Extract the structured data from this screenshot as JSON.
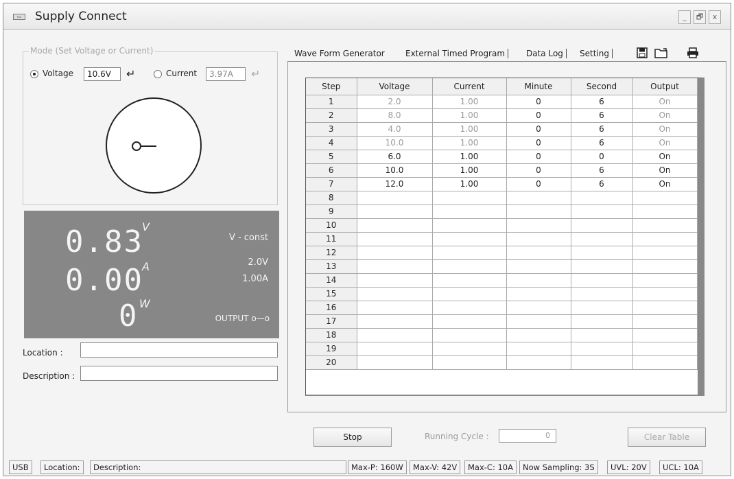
{
  "window": {
    "title": "Supply Connect",
    "app_icon": "sm-icon",
    "buttons": [
      "_",
      "🗗",
      "x"
    ]
  },
  "mode": {
    "legend": "Mode (Set Voltage or Current)",
    "voltage_label": "Voltage",
    "voltage_value": "10.6V",
    "current_label": "Current",
    "current_value": "3.97A",
    "selected": "Voltage"
  },
  "display": {
    "voltage_reading": "0.83",
    "voltage_unit": "V",
    "current_reading": "0.00",
    "current_unit": "A",
    "power_reading": "0",
    "power_unit": "W",
    "mode_text": "V - const",
    "set_voltage": "2.0V",
    "set_current": "1.00A",
    "output_text": "OUTPUT o—o"
  },
  "fields": {
    "location_label": "Location :",
    "description_label": "Description :"
  },
  "tabs": [
    "Wave Form Generator",
    "External Timed Program",
    "Data Log",
    "Setting"
  ],
  "toolbar_icons": [
    "save-icon",
    "open-icon",
    "print-icon"
  ],
  "table": {
    "headers": [
      "Step",
      "Voltage",
      "Current",
      "Minute",
      "Second",
      "Output"
    ],
    "rows": [
      {
        "step": "1",
        "voltage": "2.0",
        "current": "1.00",
        "minute": "0",
        "second": "6",
        "output": "On"
      },
      {
        "step": "2",
        "voltage": "8.0",
        "current": "1.00",
        "minute": "0",
        "second": "6",
        "output": "On"
      },
      {
        "step": "3",
        "voltage": "4.0",
        "current": "1.00",
        "minute": "0",
        "second": "6",
        "output": "On"
      },
      {
        "step": "4",
        "voltage": "10.0",
        "current": "1.00",
        "minute": "0",
        "second": "6",
        "output": "On"
      },
      {
        "step": "5",
        "voltage": "6.0",
        "current": "1.00",
        "minute": "0",
        "second": "0",
        "output": "On"
      },
      {
        "step": "6",
        "voltage": "10.0",
        "current": "1.00",
        "minute": "0",
        "second": "6",
        "output": "On"
      },
      {
        "step": "7",
        "voltage": "12.0",
        "current": "1.00",
        "minute": "0",
        "second": "6",
        "output": "On"
      },
      {
        "step": "8",
        "voltage": "",
        "current": "",
        "minute": "",
        "second": "",
        "output": ""
      },
      {
        "step": "9",
        "voltage": "",
        "current": "",
        "minute": "",
        "second": "",
        "output": ""
      },
      {
        "step": "10",
        "voltage": "",
        "current": "",
        "minute": "",
        "second": "",
        "output": ""
      },
      {
        "step": "11",
        "voltage": "",
        "current": "",
        "minute": "",
        "second": "",
        "output": ""
      },
      {
        "step": "12",
        "voltage": "",
        "current": "",
        "minute": "",
        "second": "",
        "output": ""
      },
      {
        "step": "13",
        "voltage": "",
        "current": "",
        "minute": "",
        "second": "",
        "output": ""
      },
      {
        "step": "14",
        "voltage": "",
        "current": "",
        "minute": "",
        "second": "",
        "output": ""
      },
      {
        "step": "15",
        "voltage": "",
        "current": "",
        "minute": "",
        "second": "",
        "output": ""
      },
      {
        "step": "16",
        "voltage": "",
        "current": "",
        "minute": "",
        "second": "",
        "output": ""
      },
      {
        "step": "17",
        "voltage": "",
        "current": "",
        "minute": "",
        "second": "",
        "output": ""
      },
      {
        "step": "18",
        "voltage": "",
        "current": "",
        "minute": "",
        "second": "",
        "output": ""
      },
      {
        "step": "19",
        "voltage": "",
        "current": "",
        "minute": "",
        "second": "",
        "output": ""
      },
      {
        "step": "20",
        "voltage": "",
        "current": "",
        "minute": "",
        "second": "",
        "output": ""
      }
    ]
  },
  "controls": {
    "stop_label": "Stop",
    "running_cycle_label": "Running Cycle :",
    "running_cycle_value": "0",
    "clear_table_label": "Clear Table"
  },
  "status": {
    "usb": "USB",
    "location": "Location:",
    "description": "Description:",
    "max_p": "Max-P: 160W",
    "max_v": "Max-V: 42V",
    "max_c": "Max-C: 10A",
    "sampling": "Now Sampling: 3S",
    "uvl": "UVL: 20V",
    "ucl": "UCL: 10A"
  }
}
